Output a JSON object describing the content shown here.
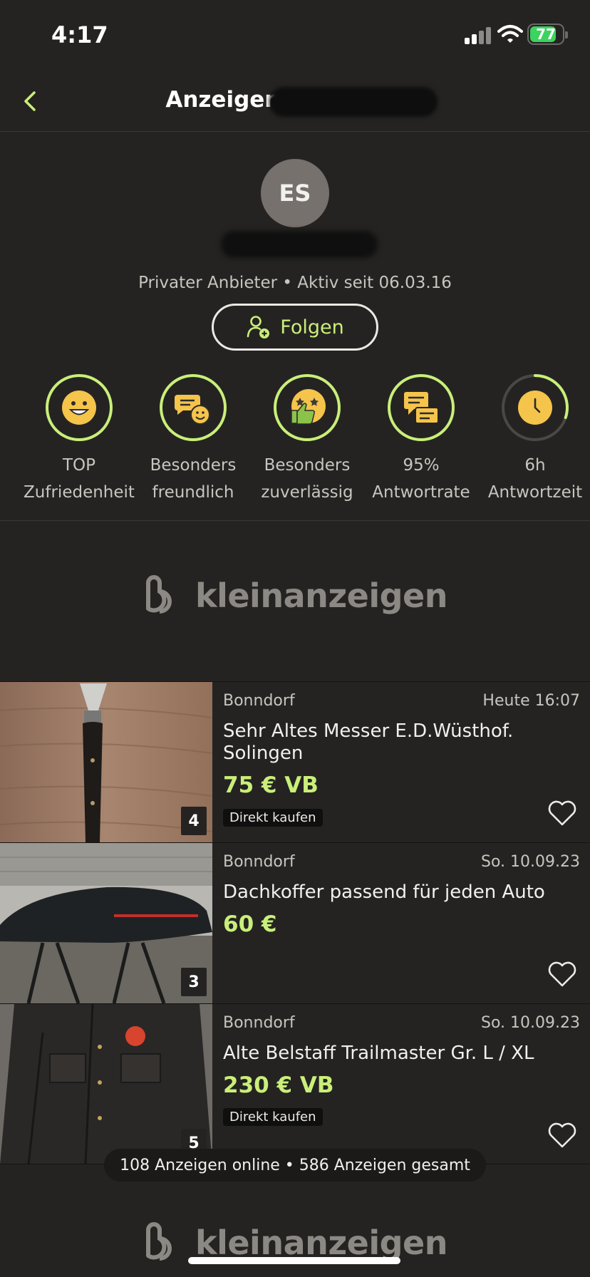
{
  "status_bar": {
    "time": "4:17",
    "battery": "77"
  },
  "header": {
    "title": "Anzeigen vo",
    "back_icon": "chevron-left-icon"
  },
  "profile": {
    "initials": "ES",
    "meta": "Privater Anbieter • Aktiv seit 06.03.16",
    "follow_label": "Folgen"
  },
  "badges": [
    {
      "line1": "TOP",
      "line2": "Zufriedenheit",
      "icon": "smiley-icon"
    },
    {
      "line1": "Besonders",
      "line2": "freundlich",
      "icon": "chat-smiley-icon"
    },
    {
      "line1": "Besonders",
      "line2": "zuverlässig",
      "icon": "thumbs-up-stars-icon"
    },
    {
      "line1": "95%",
      "line2": "Antwortrate",
      "icon": "chat-bubbles-icon"
    },
    {
      "line1": "6h",
      "line2": "Antwortzeit",
      "icon": "clock-icon"
    }
  ],
  "response_time_fraction": 0.3,
  "logo": {
    "text": "kleinanzeigen"
  },
  "listings": [
    {
      "location": "Bonndorf",
      "date": "Heute 16:07",
      "title": "Sehr Altes Messer E.D.Wüsthof. Solingen",
      "price": "75 € VB",
      "tag": "Direkt kaufen",
      "image_count": "4"
    },
    {
      "location": "Bonndorf",
      "date": "So. 10.09.23",
      "title": "Dachkoffer passend für  jeden Auto",
      "price": "60 €",
      "tag": "",
      "image_count": "3"
    },
    {
      "location": "Bonndorf",
      "date": "So. 10.09.23",
      "title": "Alte Belstaff Trailmaster Gr. L / XL",
      "price": "230 € VB",
      "tag": "Direkt kaufen",
      "image_count": "5"
    }
  ],
  "summary": "108 Anzeigen online • 586 Anzeigen gesamt",
  "colors": {
    "accent": "#c9ef79",
    "background": "#252322",
    "badge_fill": "#f5c44a"
  }
}
